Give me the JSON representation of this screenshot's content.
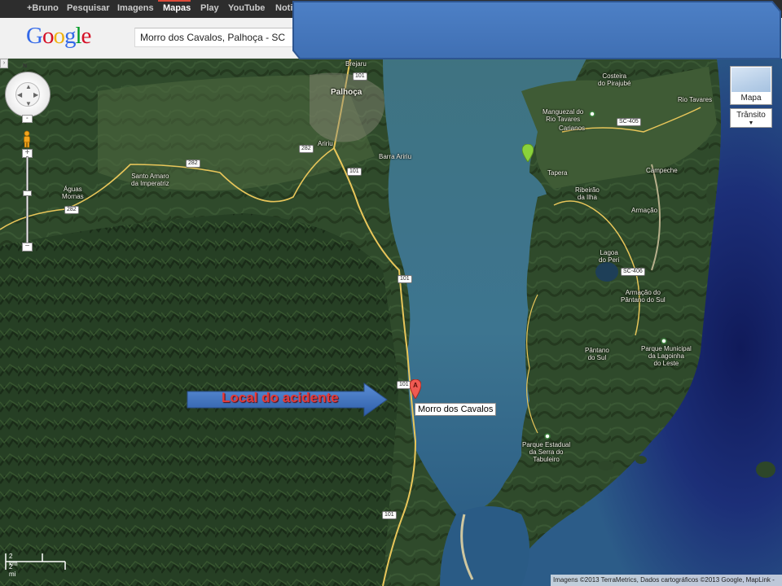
{
  "gbar": {
    "items": [
      "+Bruno",
      "Pesquisar",
      "Imagens",
      "Mapas",
      "Play",
      "YouTube",
      "Noti"
    ],
    "active": "Mapas"
  },
  "logo": {
    "text": "Google",
    "colors": [
      "#3369e8",
      "#d50f25",
      "#eeb211",
      "#3369e8",
      "#009925",
      "#d50f25"
    ]
  },
  "search": {
    "value": "Morro dos Cavalos, Palhoça - SC"
  },
  "banner": {
    "color": "#4a7cc0"
  },
  "map": {
    "places": [
      {
        "id": "brejaru",
        "text": "Brejaru"
      },
      {
        "id": "palhoca",
        "text": "Palhoça"
      },
      {
        "id": "aririu",
        "text": "Aririu"
      },
      {
        "id": "barra-aririu",
        "text": "Barra Aririu"
      },
      {
        "id": "santo-amaro",
        "text": "Santo Amaro\nda Imperatriz"
      },
      {
        "id": "aguas-mornas",
        "text": "Águas\nMornas"
      },
      {
        "id": "costeira",
        "text": "Costeira\ndo Pirajubé"
      },
      {
        "id": "manguezal",
        "text": "Manguezal do\nRio Tavares"
      },
      {
        "id": "carianos",
        "text": "Carianos"
      },
      {
        "id": "tapera",
        "text": "Tapera"
      },
      {
        "id": "ribeirao",
        "text": "Ribeirão\nda Ilha"
      },
      {
        "id": "rio-tavares",
        "text": "Rio Tavares"
      },
      {
        "id": "campeche",
        "text": "Campeche"
      },
      {
        "id": "armacao",
        "text": "Armação"
      },
      {
        "id": "lagoa-peri",
        "text": "Lagoa\ndo Peri"
      },
      {
        "id": "armacao-pantano",
        "text": "Armação do\nPântano do Sul"
      },
      {
        "id": "pantano",
        "text": "Pântano\ndo Sul"
      },
      {
        "id": "parque-lagoinha",
        "text": "Parque Municipal\nda Lagoinha\ndo Leste"
      },
      {
        "id": "parque-tabuleiro",
        "text": "Parque Estadual\nda Serra do\nTabuleiro"
      }
    ],
    "shields": [
      "101",
      "101",
      "101",
      "101",
      "101",
      "282",
      "282",
      "282",
      "SC-405",
      "SC-406"
    ],
    "marker": {
      "letter": "A",
      "label": "Morro dos Cavalos"
    },
    "annotation": "Local do acidente",
    "maptype": {
      "label": "Mapa",
      "traffic": "Trânsito"
    },
    "scale": {
      "km": "2 km",
      "mi": "2 mi"
    },
    "compass": "N",
    "copyright": "Imagens ©2013 TerraMetrics, Dados cartográficos ©2013 Google, MapLink -"
  }
}
